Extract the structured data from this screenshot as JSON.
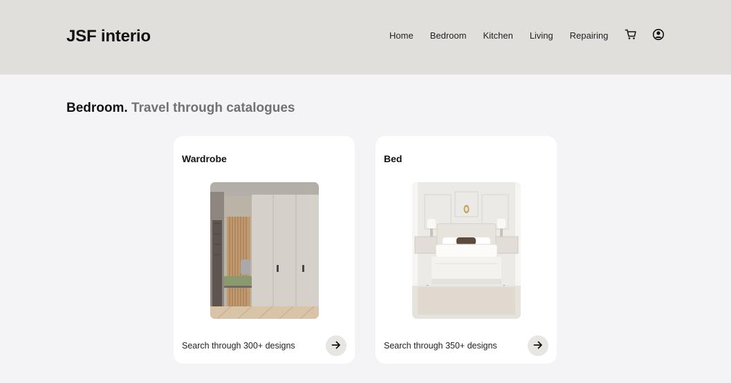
{
  "brand": {
    "logo": "JSF interio"
  },
  "nav": {
    "links": [
      "Home",
      "Bedroom",
      "Kitchen",
      "Living",
      "Repairing"
    ],
    "cart_icon": "cart-icon",
    "account_icon": "user-circle-icon"
  },
  "page": {
    "title_strong": "Bedroom.",
    "title_light": "Travel through catalogues"
  },
  "cards": [
    {
      "title": "Wardrobe",
      "description": "Search through 300+ designs",
      "image": "wardrobe-photo",
      "action_icon": "arrow-right-icon"
    },
    {
      "title": "Bed",
      "description": "Search through 350+ designs",
      "image": "bedroom-photo",
      "action_icon": "arrow-right-icon"
    }
  ],
  "colors": {
    "header_bg": "#e0dfdc",
    "page_bg": "#f4f4f6",
    "card_bg": "#ffffff",
    "muted_text": "#707075",
    "button_bg": "#e8e6e3"
  }
}
